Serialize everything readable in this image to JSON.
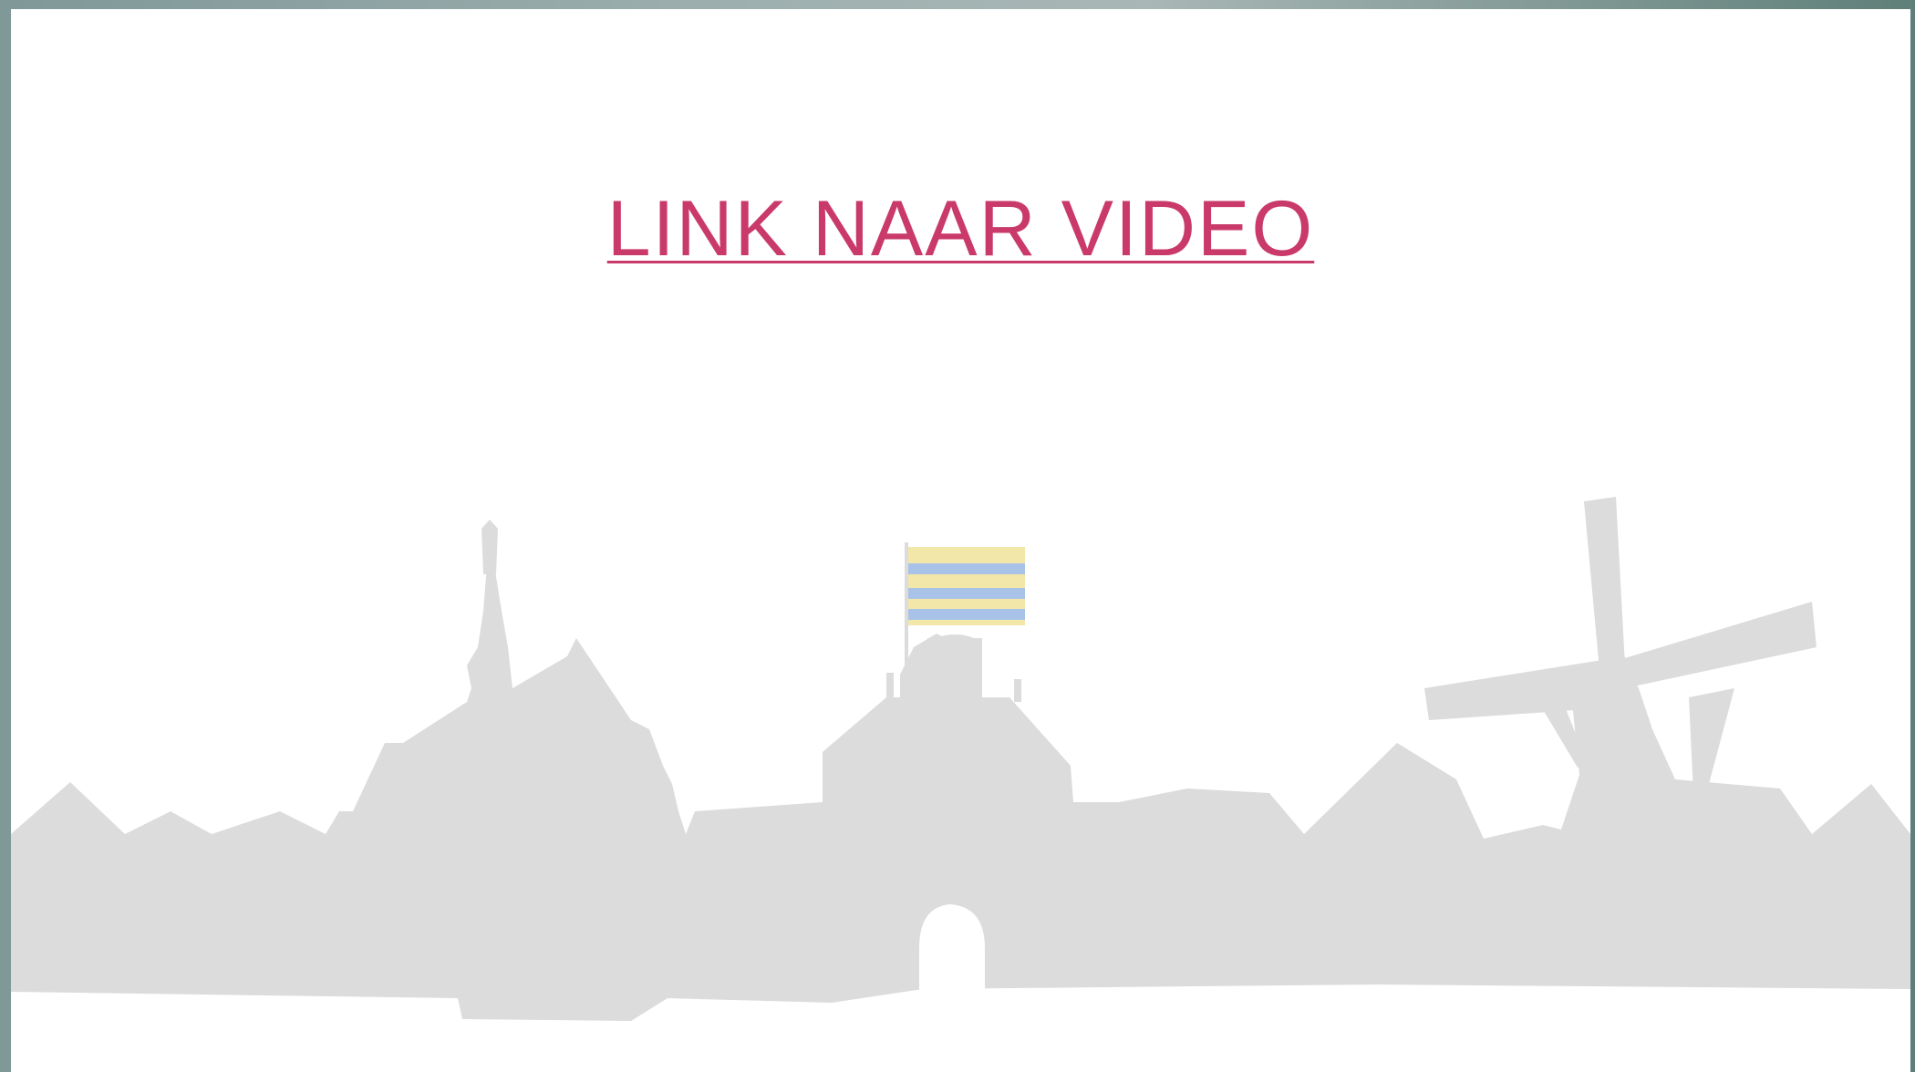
{
  "slide": {
    "link_label": "LINK NAAR VIDEO",
    "link_color": "#c93a6a"
  },
  "illustration": {
    "name": "town-skyline-silhouette",
    "silhouette_color": "#dcdcdc",
    "flag_colors": [
      "#f2e6a8",
      "#a9c3e8"
    ]
  }
}
